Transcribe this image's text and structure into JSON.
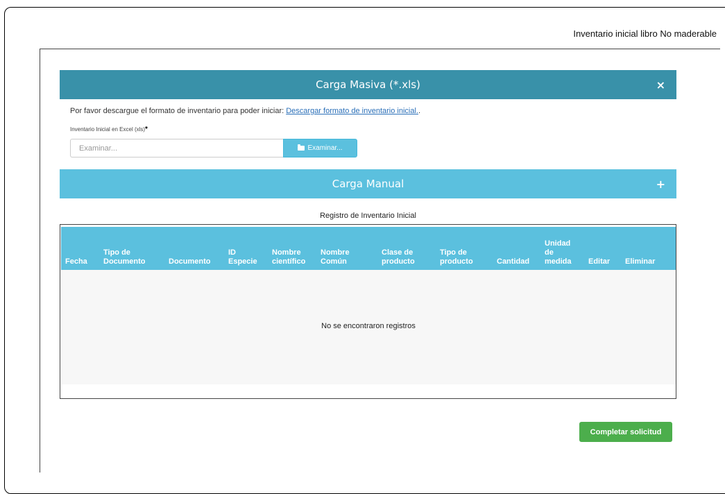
{
  "header": {
    "title": "Inventario inicial libro No maderable"
  },
  "carga_masiva": {
    "title": "Carga Masiva (*.xls)",
    "close_glyph": "×",
    "instruction_text": "Por favor descargue el formato de inventario para poder iniciar: ",
    "download_link": "Descargar formato de inventario inicial.",
    "instruction_end": ".",
    "file_label": "Inventario Inicial en Excel (xls)",
    "required_mark": "*",
    "file_placeholder": "Examinar...",
    "browse_label": "Examinar...",
    "browse_icon": "folder-icon"
  },
  "carga_manual": {
    "title": "Carga Manual",
    "expand_glyph": "+"
  },
  "table": {
    "caption": "Registro de Inventario Inicial",
    "columns": [
      [
        "Fecha"
      ],
      [
        "Tipo de",
        "Documento"
      ],
      [
        "Documento"
      ],
      [
        "ID",
        "Especie"
      ],
      [
        "Nombre",
        "científico"
      ],
      [
        "Nombre",
        "Común"
      ],
      [
        "Clase de",
        "producto"
      ],
      [
        "Tipo de",
        "producto"
      ],
      [
        "Cantidad"
      ],
      [
        "Unidad",
        "de",
        "medida"
      ],
      [
        "Editar"
      ],
      [
        "Eliminar"
      ]
    ],
    "empty_message": "No se encontraron registros"
  },
  "footer": {
    "submit_label": "Completar solicitud"
  },
  "colors": {
    "primary_dark": "#3991a9",
    "info": "#5bc0de",
    "success": "#4cae4c",
    "link": "#2a6fb8"
  }
}
